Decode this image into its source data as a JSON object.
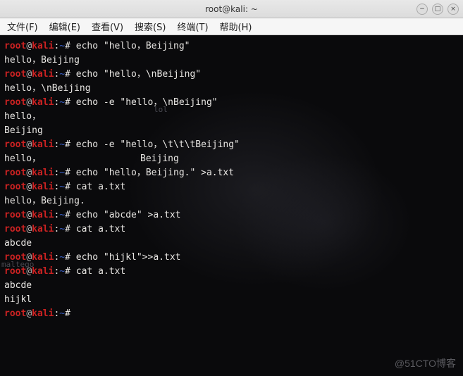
{
  "window": {
    "title": "root@kali: ~",
    "controls": {
      "min": "−",
      "max": "□",
      "close": "×"
    }
  },
  "menubar": {
    "items": [
      {
        "label": "文件(F)"
      },
      {
        "label": "编辑(E)"
      },
      {
        "label": "查看(V)"
      },
      {
        "label": "搜索(S)"
      },
      {
        "label": "终端(T)"
      },
      {
        "label": "帮助(H)"
      }
    ]
  },
  "prompt": {
    "user": "root",
    "at": "@",
    "host": "kali",
    "sep": ":",
    "path": "~",
    "hash": "# "
  },
  "session": [
    {
      "type": "cmd",
      "text": "echo \"hello，Beijing\""
    },
    {
      "type": "out",
      "text": "hello，Beijing"
    },
    {
      "type": "cmd",
      "text": "echo \"hello，\\nBeijing\""
    },
    {
      "type": "out",
      "text": "hello，\\nBeijing"
    },
    {
      "type": "cmd",
      "text": "echo -e \"hello，\\nBeijing\""
    },
    {
      "type": "out",
      "text": "hello，"
    },
    {
      "type": "out",
      "text": "Beijing"
    },
    {
      "type": "cmd",
      "text": "echo -e \"hello，\\t\\t\\tBeijing\""
    },
    {
      "type": "out",
      "text": "hello，                  Beijing"
    },
    {
      "type": "cmd",
      "text": "echo \"hello，Beijing.\" >a.txt"
    },
    {
      "type": "cmd",
      "text": "cat a.txt"
    },
    {
      "type": "out",
      "text": "hello，Beijing."
    },
    {
      "type": "cmd",
      "text": "echo \"abcde\" >a.txt"
    },
    {
      "type": "cmd",
      "text": "cat a.txt"
    },
    {
      "type": "out",
      "text": "abcde"
    },
    {
      "type": "cmd",
      "text": "echo \"hijkl\">>a.txt"
    },
    {
      "type": "cmd",
      "text": "cat a.txt"
    },
    {
      "type": "out",
      "text": "abcde"
    },
    {
      "type": "out",
      "text": "hijkl"
    },
    {
      "type": "cmd",
      "text": ""
    }
  ],
  "background_hints": {
    "lol": "lol",
    "maltego": "maltego"
  },
  "watermark": "@51CTO博客"
}
